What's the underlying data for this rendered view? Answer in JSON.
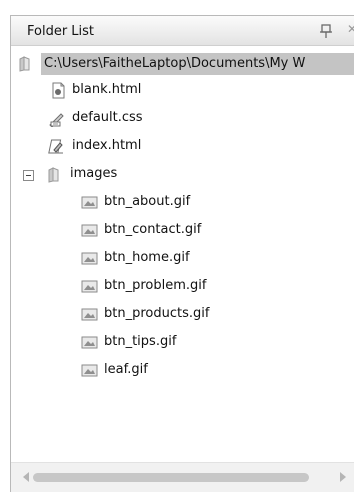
{
  "panel": {
    "title": "Folder List"
  },
  "tree": {
    "root": {
      "label": "C:\\Users\\FaitheLaptop\\Documents\\My W"
    },
    "files": [
      {
        "label": "blank.html",
        "icon": "html-page-icon"
      },
      {
        "label": "default.css",
        "icon": "css-file-icon"
      },
      {
        "label": "index.html",
        "icon": "home-page-icon"
      }
    ],
    "folder": {
      "label": "images",
      "icon": "folder-icon",
      "expanded": true
    },
    "images": [
      {
        "label": "btn_about.gif"
      },
      {
        "label": "btn_contact.gif"
      },
      {
        "label": "btn_home.gif"
      },
      {
        "label": "btn_problem.gif"
      },
      {
        "label": "btn_products.gif"
      },
      {
        "label": "btn_tips.gif"
      },
      {
        "label": "leaf.gif"
      }
    ]
  }
}
